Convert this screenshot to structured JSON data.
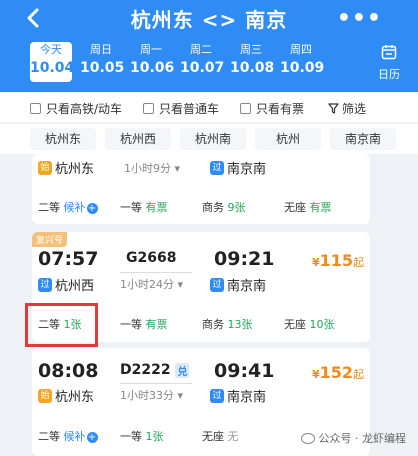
{
  "header": {
    "title": "杭州东 <> 南京"
  },
  "dates": [
    {
      "weekday": "今天",
      "date": "10.04"
    },
    {
      "weekday": "周日",
      "date": "10.05"
    },
    {
      "weekday": "周一",
      "date": "10.06"
    },
    {
      "weekday": "周二",
      "date": "10.07"
    },
    {
      "weekday": "周三",
      "date": "10.08"
    },
    {
      "weekday": "周四",
      "date": "10.09"
    }
  ],
  "calendar": {
    "label": "日历"
  },
  "filters": [
    {
      "label": "只看高铁/动车"
    },
    {
      "label": "只看普通车"
    },
    {
      "label": "只看有票"
    }
  ],
  "filter_button": {
    "label": "筛选"
  },
  "stations": [
    "杭州东",
    "杭州西",
    "杭州南",
    "杭州",
    "南京南"
  ],
  "trains": [
    {
      "depart_tag": "始",
      "depart_station": "杭州东",
      "duration": "1小时9分",
      "arrive_tag": "过",
      "arrive_station": "南京南",
      "seats": {
        "s1": "二等",
        "s1v": "候补",
        "s2": "一等",
        "s2v": "有票",
        "s3": "商务",
        "s3v": "9张",
        "s4": "无座",
        "s4v": "有票"
      }
    },
    {
      "badge": "复兴号",
      "depart_time": "07:57",
      "train_no": "G2668",
      "arrive_time": "09:21",
      "price_symbol": "¥",
      "price": "115",
      "price_suffix": "起",
      "depart_tag": "过",
      "depart_station": "杭州西",
      "duration": "1小时24分",
      "arrive_tag": "过",
      "arrive_station": "南京南",
      "seats": {
        "s1": "二等",
        "s1v": "1张",
        "s2": "一等",
        "s2v": "有票",
        "s3": "商务",
        "s3v": "13张",
        "s4": "无座",
        "s4v": "10张"
      }
    },
    {
      "depart_time": "08:08",
      "train_no": "D2222",
      "train_flag": "兑",
      "arrive_time": "09:41",
      "price_symbol": "¥",
      "price": "152",
      "price_suffix": "起",
      "depart_tag": "始",
      "depart_station": "杭州东",
      "duration": "1小时33分",
      "arrive_tag": "过",
      "arrive_station": "南京南",
      "seats": {
        "s1": "二等",
        "s1v": "候补",
        "s2": "一等",
        "s2v": "1张",
        "s3": "无座",
        "s3v": "无"
      }
    }
  ],
  "watermark": {
    "text": "公众号 · 龙虾编程"
  },
  "colors": {
    "primary": "#2f8cf5",
    "available": "#25a35a",
    "price": "#f28b1a",
    "highlight": "#e03a3a"
  }
}
